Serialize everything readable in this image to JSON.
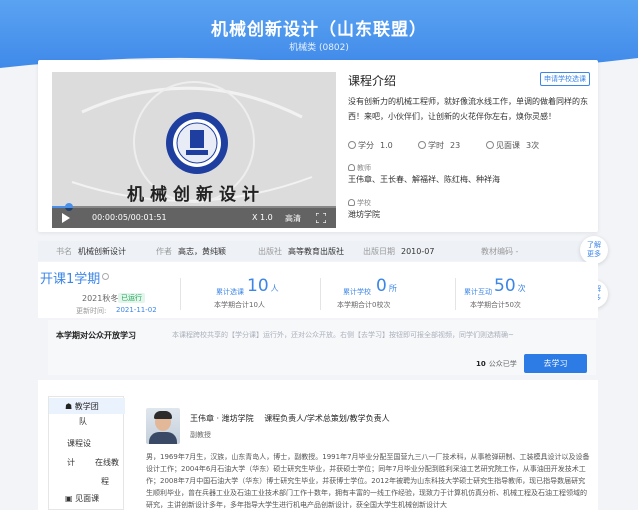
{
  "header": {
    "title": "机械创新设计（山东联盟）",
    "subtitle": "机械类 (0802)"
  },
  "video": {
    "calligraphy_text": "机械创新设计",
    "time": "00:00:05/00:01:51",
    "speed": "X 1.0",
    "quality": "高清",
    "progress": 0.06
  },
  "intro": {
    "title": "课程介绍",
    "apply_button": "申请学校选课",
    "text": "没有创新力的机械工程师，就好像流水线工作，单调的做着同样的东西！来吧，小伙伴们，让创新的火花伴你左右，焕你灵感！",
    "stats": [
      {
        "label": "学分",
        "value": "1.0"
      },
      {
        "label": "学时",
        "value": "23"
      },
      {
        "label": "见面课",
        "value": "3次"
      }
    ],
    "teachers_label": "教师",
    "teachers": "王伟章、王长春、解福祥、陈红梅、种祥海",
    "school_label": "学校",
    "school": "潍坊学院"
  },
  "book": {
    "name_label": "书名",
    "name": "机械创新设计",
    "author_label": "作者",
    "author": "高志，黄纯颖",
    "publisher_label": "出版社",
    "publisher": "高等教育出版社",
    "date_label": "出版日期",
    "date": "2010-07",
    "code_label": "教材编码 -"
  },
  "float_buttons": [
    {
      "line1": "了解",
      "line2": "更多"
    },
    {
      "line1": "了解",
      "line2": "更多"
    }
  ],
  "semester": {
    "title": "开课1学期",
    "term": "2021秋冬",
    "status": "已运行",
    "update_label": "更新时间:",
    "update_date": "2021-11-02",
    "metrics": [
      {
        "label": "累计选课",
        "value": "10",
        "unit": "人",
        "sub": "本学期合计10人"
      },
      {
        "label": "累计学校",
        "value": "0",
        "unit": "所",
        "sub": "本学期合计0校次"
      },
      {
        "label": "累计互动",
        "value": "50",
        "unit": "次",
        "sub": "本学期合计50次"
      }
    ]
  },
  "open_course": {
    "title": "本学期对公众开放学习",
    "desc": "本课程跨校共享的【学分课】运行外，还对公众开放。右侧【去学习】按钮即可报全部视频，同学们则选精确~",
    "school_count_value": "10",
    "school_count_label": "公众已学",
    "go_button": "去学习"
  },
  "team": {
    "nav": [
      {
        "label": "教学团"
      },
      {
        "label": "队"
      },
      {
        "label": "课程设"
      },
      {
        "label": "计"
      },
      {
        "label": "在线教"
      },
      {
        "label": "程"
      },
      {
        "label": "见面课"
      }
    ],
    "teacher_name": "王伟章 · 潍坊学院",
    "teacher_role": "课程负责人/学术总策划/教学负责人",
    "teacher_title": "副教授",
    "bio": "男，1969年7月生，汉族，山东青岛人，博士，副教授。1991年7月毕业分配至国营九三八一厂技术科，从事枪弹研制、工装模具设计以及设备设计工作；2004年6月石油大学（华东）硕士研究生毕业，并获硕士学位；同年7月毕业分配到胜利采油工艺研究院工作，从事油田开发技术工作；2008年7月中国石油大学（华东）博士研究生毕业，并获博士学位。2012年被聘为山东科技大学硕士研究生指导教师，现已指导数届研究生顺利毕业，曾在兵器工业及石油工业技术部门工作十数年，拥有丰富的一线工作经验，现致力于计算机仿真分析、机械工程及石油工程领域的研究，主讲创新设计多年，多年指导大学生进行机电产品创新设计，获全国大学生机械创新设计大"
  }
}
